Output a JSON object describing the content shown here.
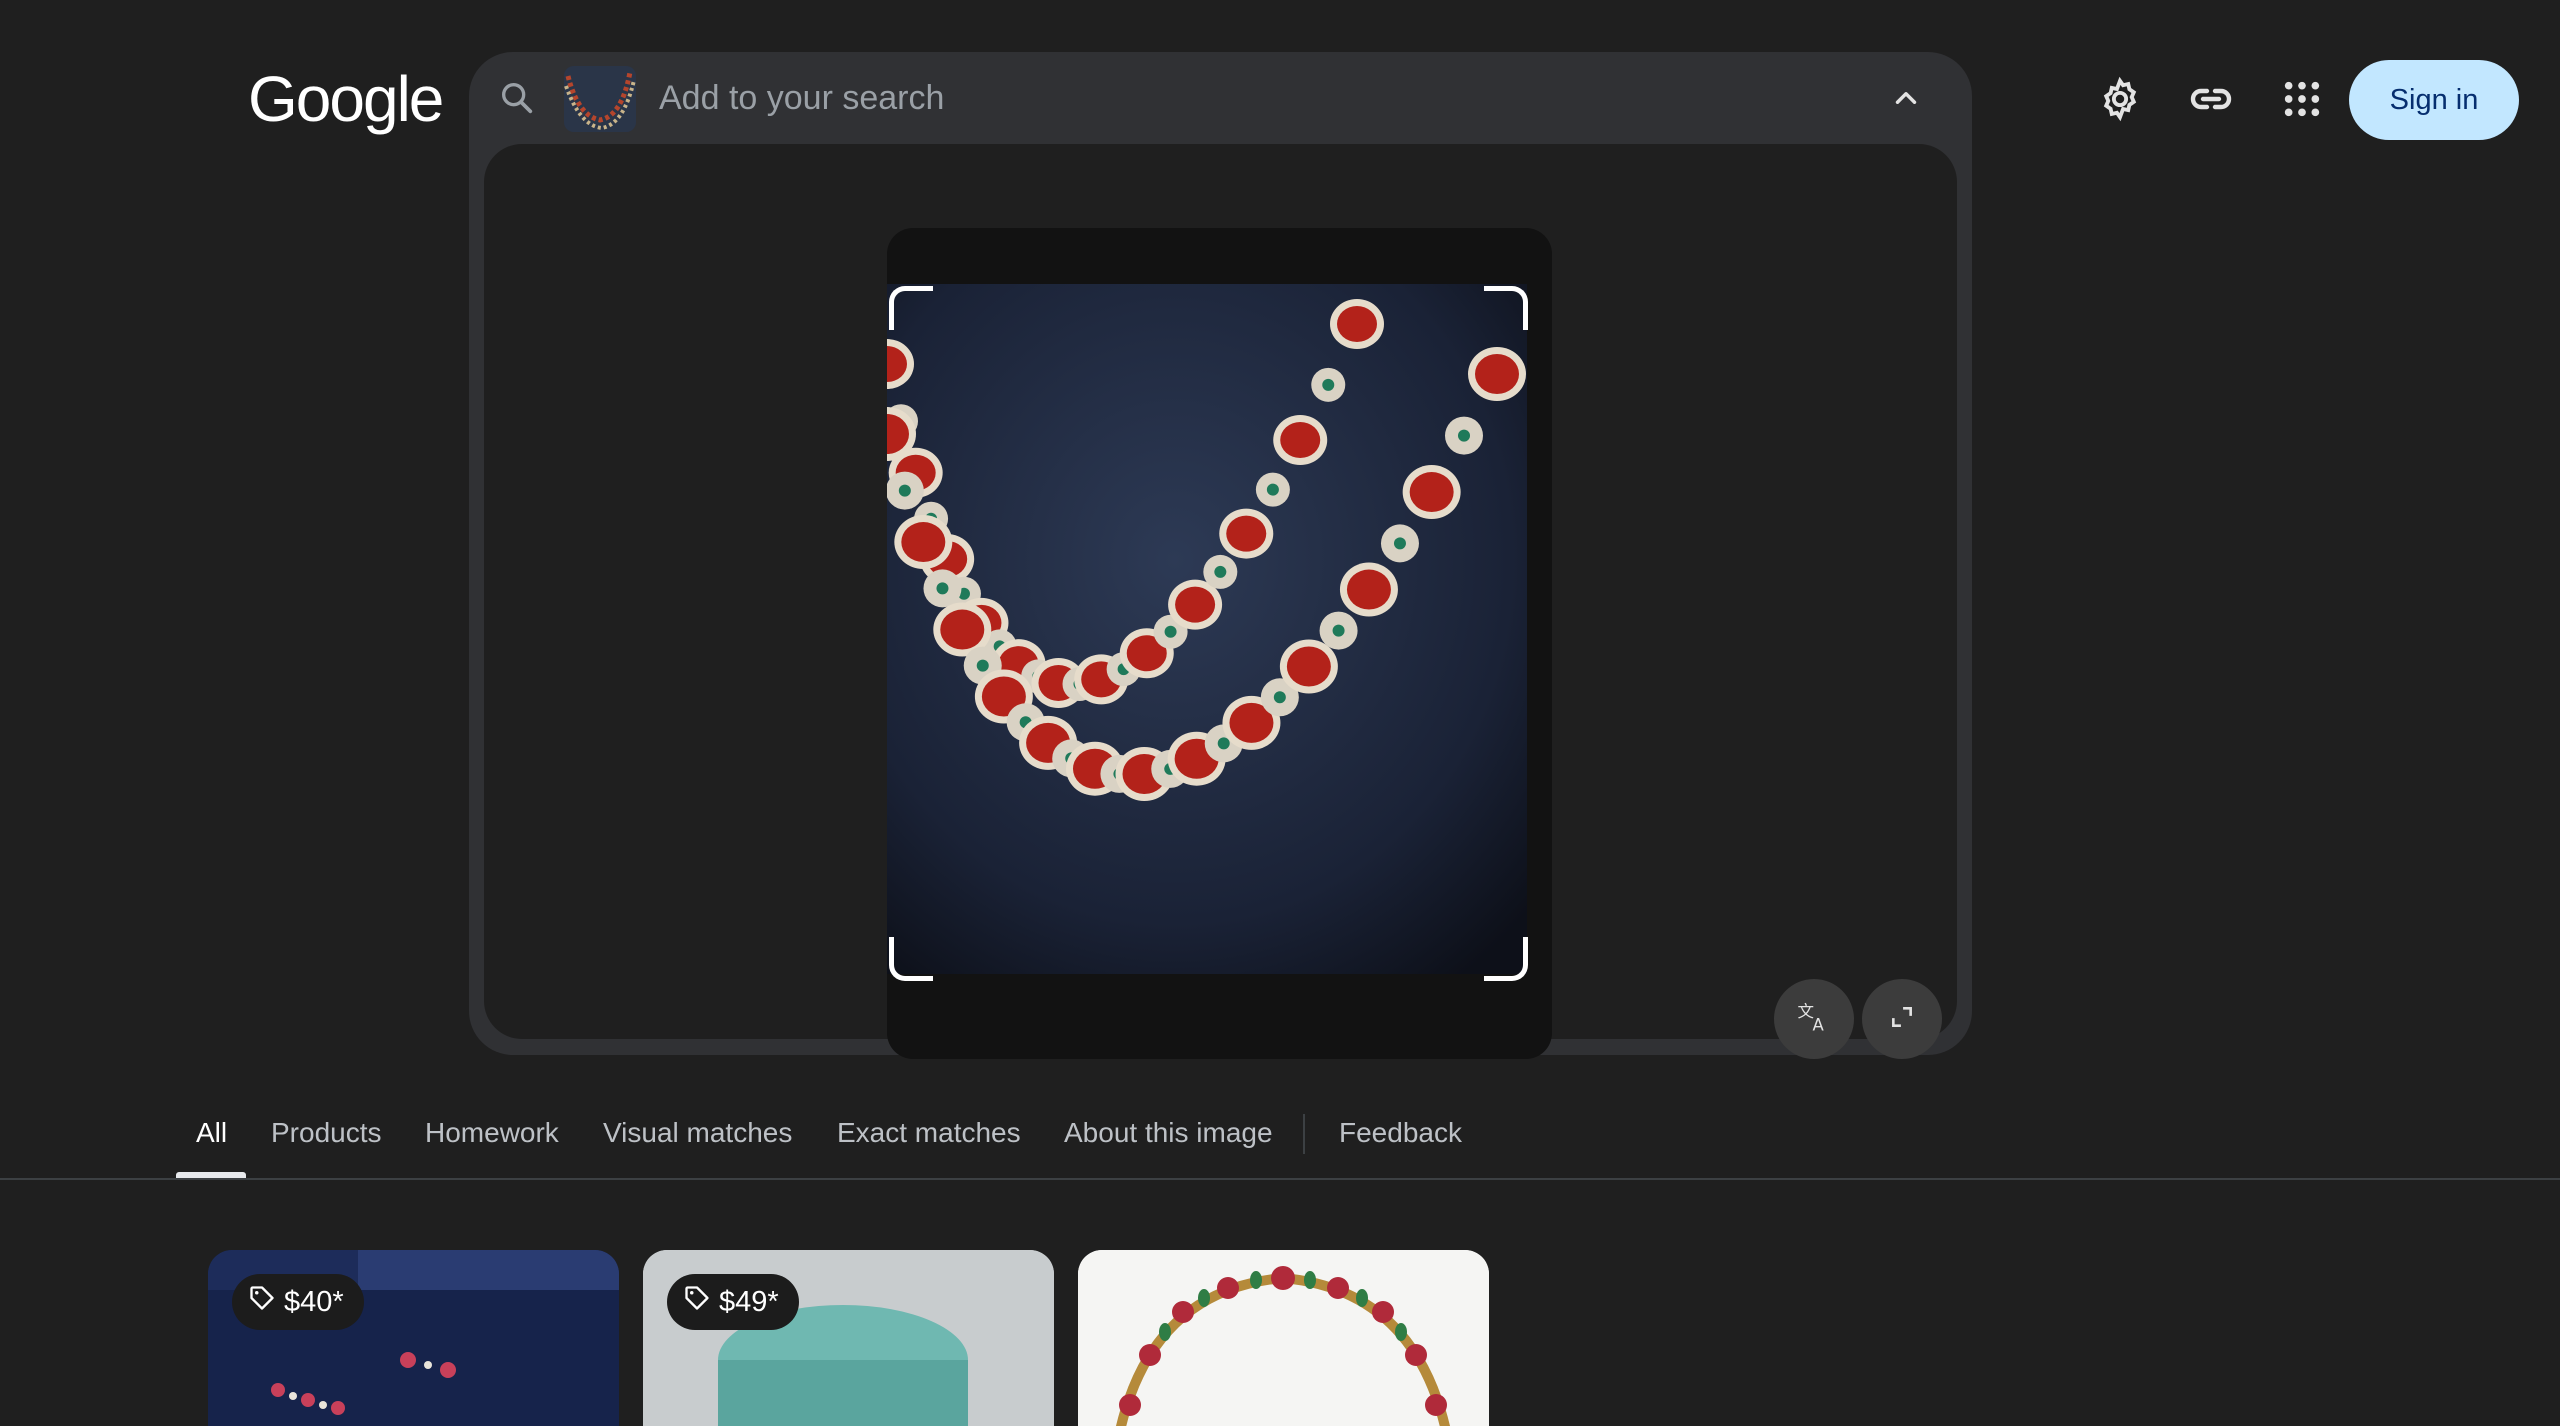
{
  "logo": {
    "text": "Google"
  },
  "search": {
    "placeholder": "Add to your search",
    "query": ""
  },
  "icons": {
    "search": "search-icon",
    "collapse": "chevron-up-icon",
    "translate": "translate-icon",
    "expand": "expand-icon",
    "settings": "gear-icon",
    "link": "link-icon",
    "apps": "apps-grid-icon",
    "price_tag": "tag-icon"
  },
  "header": {
    "signin_label": "Sign in"
  },
  "tabs": [
    {
      "label": "All",
      "active": true
    },
    {
      "label": "Products",
      "active": false
    },
    {
      "label": "Homework",
      "active": false
    },
    {
      "label": "Visual matches",
      "active": false
    },
    {
      "label": "Exact matches",
      "active": false
    },
    {
      "label": "About this image",
      "active": false
    },
    {
      "label": "Feedback",
      "active": false
    }
  ],
  "results": [
    {
      "price": "$40*"
    },
    {
      "price": "$49*"
    },
    {
      "price": ""
    }
  ],
  "colors": {
    "background": "#1f1f1f",
    "panel": "#303134",
    "signin_bg": "#c2e7ff",
    "signin_text": "#062e6f"
  }
}
